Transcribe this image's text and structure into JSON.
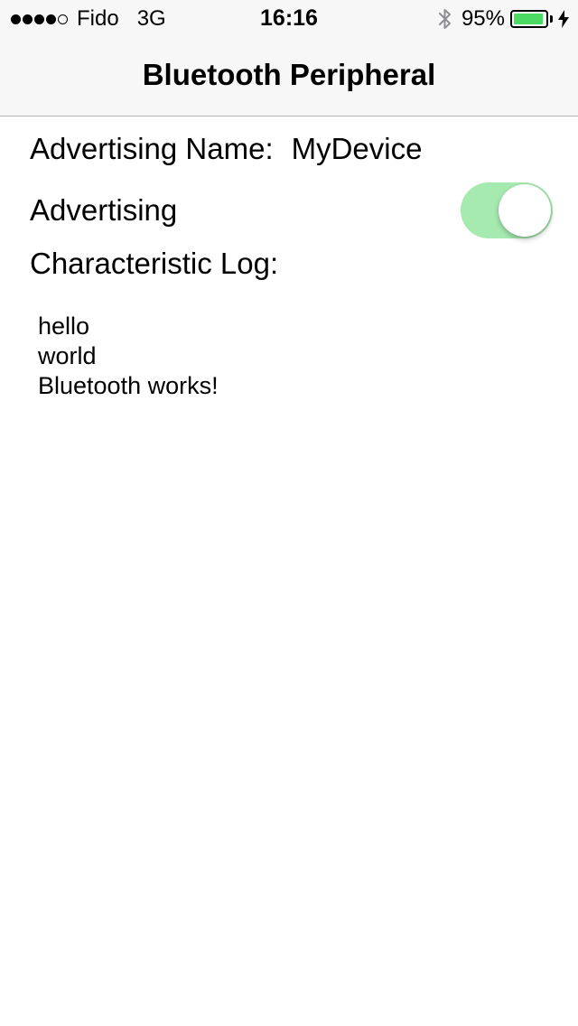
{
  "status_bar": {
    "signal_dots_filled": 4,
    "signal_dots_total": 5,
    "carrier": "Fido",
    "network": "3G",
    "time": "16:16",
    "bluetooth_icon": "bluetooth-icon",
    "battery_percent_label": "95%",
    "battery_level": 0.95,
    "battery_color": "#4cd964",
    "charging_icon": "lightning-bolt-icon"
  },
  "nav": {
    "title": "Bluetooth Peripheral"
  },
  "advertising_name": {
    "label": "Advertising Name:",
    "value": "MyDevice"
  },
  "advertising": {
    "label": "Advertising",
    "toggle_on": true,
    "toggle_on_color": "#a6eab0"
  },
  "characteristic_log": {
    "label": "Characteristic Log:",
    "lines": [
      "hello",
      "world",
      "Bluetooth works!"
    ]
  }
}
